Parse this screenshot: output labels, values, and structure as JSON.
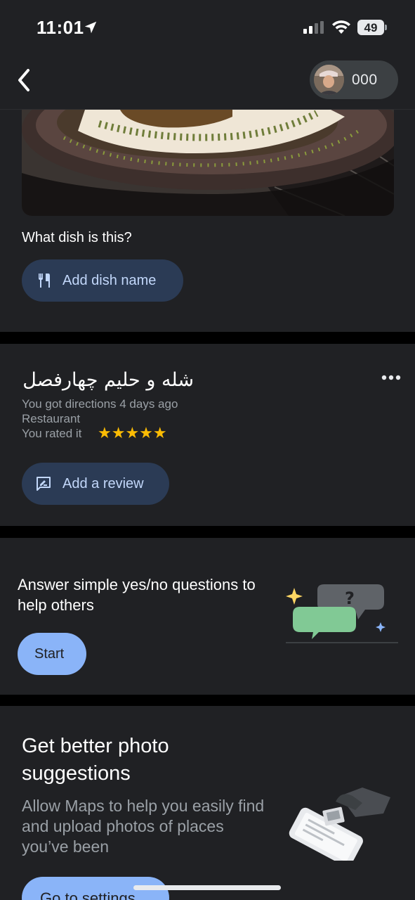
{
  "status_bar": {
    "time": "11:01",
    "battery_percent": "49"
  },
  "header": {
    "points": "000"
  },
  "dish_card": {
    "question": "What dish is this?",
    "add_dish_label": "Add dish name"
  },
  "place_card": {
    "name": "شله و حلیم چهارفصل",
    "directions_text": "You got directions 4 days ago",
    "category": "Restaurant",
    "rated_text": "You rated it",
    "rating_stars": "★★★★★",
    "rating_value": 5,
    "add_review_label": "Add a review"
  },
  "qa_card": {
    "prompt": "Answer simple yes/no questions to help others",
    "start_label": "Start"
  },
  "photo_card": {
    "title": "Get better photo suggestions",
    "body": "Allow Maps to help you easily find and upload photos of places you’ve been",
    "settings_label": "Go to settings"
  },
  "colors": {
    "background": "#202124",
    "separator": "#000000",
    "accent_blue": "#8ab4f8",
    "pill_bg": "#2b3b55",
    "star_yellow": "#fbbc04",
    "bubble_green": "#81c995"
  }
}
